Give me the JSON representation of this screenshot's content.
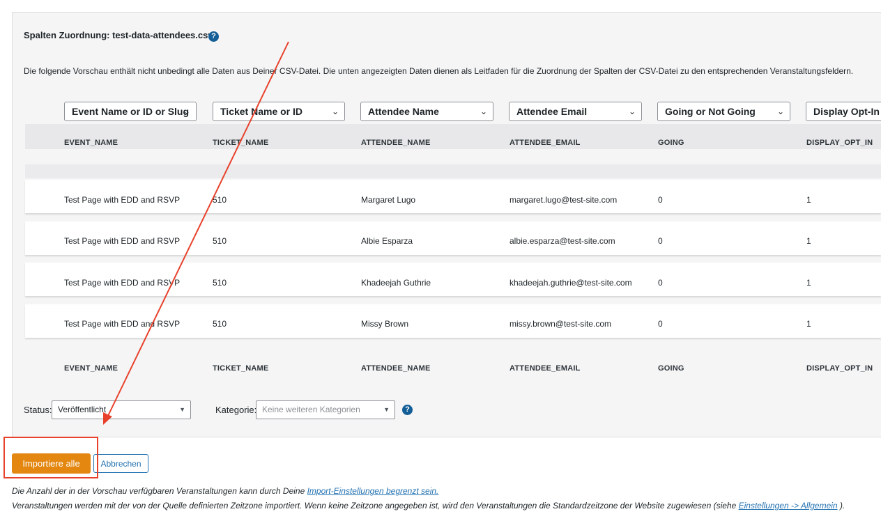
{
  "mapping": {
    "heading": "Spalten Zuordnung: test-data-attendees.csv",
    "help_symbol": "?",
    "description": "Die folgende Vorschau enthält nicht unbedingt alle Daten aus Deiner CSV-Datei. Die unten angezeigten Daten dienen als Leitfaden für die Zuordnung der Spalten der CSV-Datei zu den entsprechenden Veranstaltungsfeldern."
  },
  "column_selects": [
    {
      "value": "Event Name or ID or Slug",
      "icon": "chevron-down-icon"
    },
    {
      "value": "Ticket Name or ID",
      "icon": "chevron-down-icon"
    },
    {
      "value": "Attendee Name",
      "icon": "chevron-down-icon"
    },
    {
      "value": "Attendee Email",
      "icon": "chevron-down-icon"
    },
    {
      "value": "Going or Not Going",
      "icon": "chevron-down-icon"
    },
    {
      "value": "Display Opt-In",
      "icon": "chevron-down-icon"
    }
  ],
  "table": {
    "headers": [
      "EVENT_NAME",
      "TICKET_NAME",
      "ATTENDEE_NAME",
      "ATTENDEE_EMAIL",
      "GOING",
      "DISPLAY_OPT_IN"
    ],
    "rows": [
      [
        "Test Page with EDD and RSVP",
        "510",
        "Margaret Lugo",
        "margaret.lugo@test-site.com",
        "0",
        "1"
      ],
      [
        "Test Page with EDD and RSVP",
        "510",
        "Albie Esparza",
        "albie.esparza@test-site.com",
        "0",
        "1"
      ],
      [
        "Test Page with EDD and RSVP",
        "510",
        "Khadeejah Guthrie",
        "khadeejah.guthrie@test-site.com",
        "0",
        "1"
      ],
      [
        "Test Page with EDD and RSVP",
        "510",
        "Missy Brown",
        "missy.brown@test-site.com",
        "0",
        "1"
      ]
    ]
  },
  "filters": {
    "status_label": "Status:",
    "status_value": "Veröffentlicht",
    "category_label": "Kategorie:",
    "category_placeholder": "Keine weiteren Kategorien"
  },
  "actions": {
    "import_all": "Importiere alle",
    "cancel": "Abbrechen"
  },
  "notes": {
    "line1_text": "Die Anzahl der in der Vorschau verfügbaren Veranstaltungen kann durch Deine ",
    "line1_link": "Import-Einstellungen begrenzt sein.",
    "line2_text": "Veranstaltungen werden mit der von der Quelle definierten Zeitzone importiert. Wenn keine Zeitzone angegeben ist, wird den Veranstaltungen die Standardzeitzone der Website zugewiesen (siehe ",
    "line2_link": "Einstellungen -> Allgemein",
    "line2_end": " )."
  },
  "colors": {
    "primary_button": "#e38710",
    "link": "#2271b1",
    "annotation_red": "#e8412b"
  }
}
